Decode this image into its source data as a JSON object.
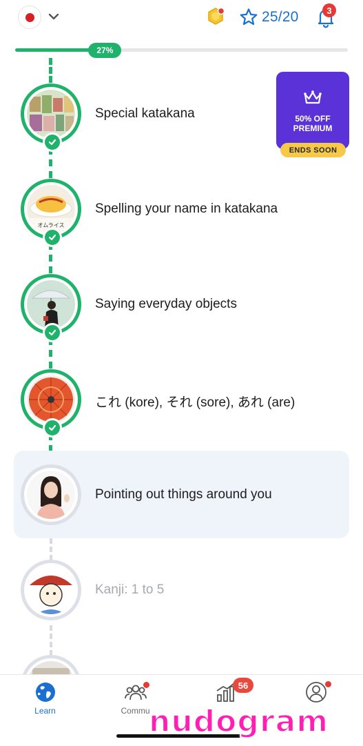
{
  "header": {
    "language_flag": "japan-flag-icon",
    "coins_icon": "coin-icon",
    "stars_text": "25/20",
    "notifications_count": "3"
  },
  "progress": {
    "label": "27%",
    "value": 0.27,
    "color": "#1fb26a"
  },
  "promo": {
    "title_line1": "50% OFF",
    "title_line2": "PREMIUM",
    "badge": "ENDS SOON",
    "color": "#5b32d8",
    "badge_color": "#f7c948"
  },
  "lessons": [
    {
      "title": "Special katakana",
      "completed": true
    },
    {
      "title": "Spelling your name in katakana",
      "completed": true,
      "image_text": "オムライス"
    },
    {
      "title": "Saying everyday objects",
      "completed": true
    },
    {
      "title": "これ (kore), それ (sore), あれ (are)",
      "completed": true
    },
    {
      "title": "Pointing out things around you",
      "completed": false,
      "current": true
    },
    {
      "title": "Kanji: 1 to 5",
      "completed": false,
      "locked": true
    }
  ],
  "nav": {
    "items": [
      {
        "label": "Learn",
        "active": true
      },
      {
        "label": "Commu",
        "dot": true
      },
      {
        "label": "",
        "badge": "56"
      },
      {
        "label": "",
        "dot": true
      }
    ]
  },
  "watermark": "nudogram"
}
